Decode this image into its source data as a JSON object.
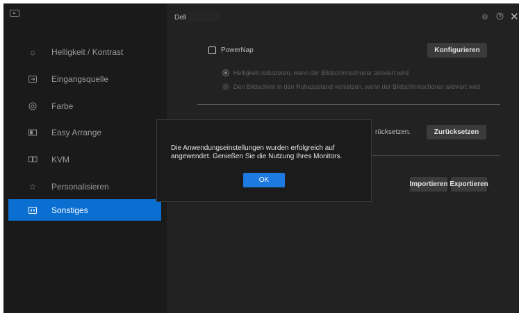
{
  "window": {
    "title": "Dell"
  },
  "sidebar": {
    "items": [
      {
        "label": "Helligkeit / Kontrast",
        "icon": "brightness-icon"
      },
      {
        "label": "Eingangsquelle",
        "icon": "input-source-icon"
      },
      {
        "label": "Farbe",
        "icon": "color-icon"
      },
      {
        "label": "Easy Arrange",
        "icon": "easy-arrange-icon"
      },
      {
        "label": "KVM",
        "icon": "kvm-icon"
      },
      {
        "label": "Personalisieren",
        "icon": "star-icon"
      },
      {
        "label": "Sonstiges",
        "icon": "others-icon"
      }
    ],
    "active_item": "Sonstiges"
  },
  "powernap": {
    "label": "PowerNap",
    "configure_button": "Konfigurieren",
    "options": [
      "Helligkeit reduzieren, wenn der Bildschirmschoner aktiviert wird",
      "Den Bildschirm in den Ruhezustand versetzen, wenn der Bildschirmschoner aktiviert wird"
    ]
  },
  "reset": {
    "label_fragment": "rücksetzen.",
    "button": "Zurücksetzen"
  },
  "settings": {
    "import_button": "Importieren",
    "export_button": "Exportieren"
  },
  "dialog": {
    "message": "Die Anwendungseinstellungen wurden erfolgreich auf angewendet. Genießen Sie die Nutzung Ihres Monitors.",
    "ok_button": "OK"
  },
  "colors": {
    "accent": "#0b6fd1",
    "ok_button": "#1c7ae0",
    "background": "#222222",
    "sidebar": "#1a1a1a"
  }
}
